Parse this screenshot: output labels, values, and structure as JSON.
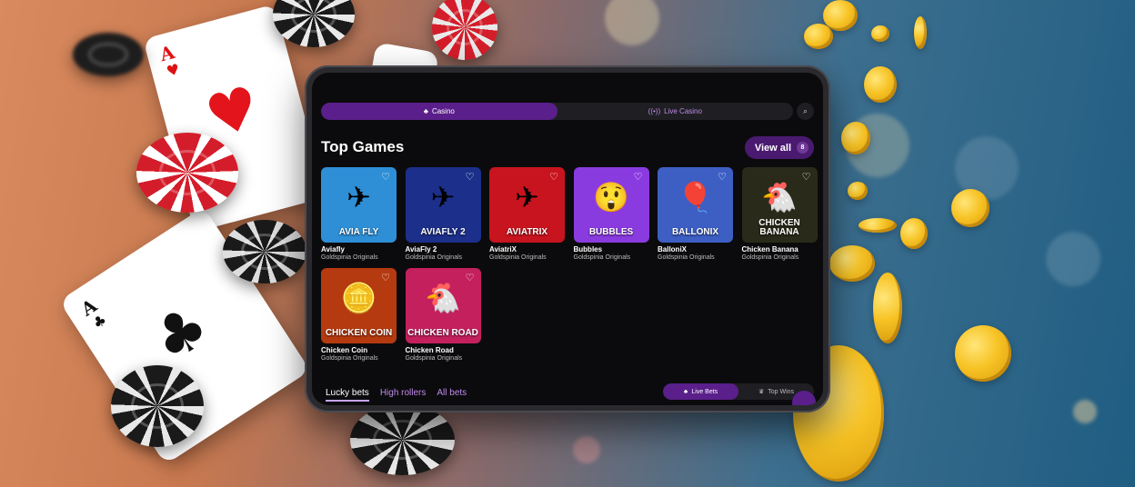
{
  "nav": {
    "casino_label": "Casino",
    "live_casino_label": "Live Casino",
    "search_icon": "search-icon"
  },
  "top_games": {
    "title": "Top Games",
    "view_all_label": "View all",
    "view_all_count": "8"
  },
  "games": [
    {
      "name": "Aviafly",
      "provider": "Goldspinia Originals",
      "logo": "AVIA FLY",
      "art": "✈",
      "bg": "#2e8fd6"
    },
    {
      "name": "AviaFly 2",
      "provider": "Goldspinia Originals",
      "logo": "AVIAFLY 2",
      "art": "✈",
      "bg": "#1c2f8a"
    },
    {
      "name": "AviatriX",
      "provider": "Goldspinia Originals",
      "logo": "AVIATRIX",
      "art": "✈",
      "bg": "#c8141e"
    },
    {
      "name": "Bubbles",
      "provider": "Goldspinia Originals",
      "logo": "BUBBLES",
      "art": "😲",
      "bg": "#8a3be0"
    },
    {
      "name": "BalloniX",
      "provider": "Goldspinia Originals",
      "logo": "BALLONIX",
      "art": "🎈",
      "bg": "#3d5fc4"
    },
    {
      "name": "Chicken Banana",
      "provider": "Goldspinia Originals",
      "logo": "CHICKEN BANANA",
      "art": "🐔",
      "bg": "#2a2a1a"
    },
    {
      "name": "Chicken Coin",
      "provider": "Goldspinia Originals",
      "logo": "CHICKEN COIN",
      "art": "🪙",
      "bg": "#b53a10"
    },
    {
      "name": "Chicken Road",
      "provider": "Goldspinia Originals",
      "logo": "CHICKEN ROAD",
      "art": "🐔",
      "bg": "#c4205e"
    }
  ],
  "bets": {
    "tabs": [
      "Lucky bets",
      "High rollers",
      "All bets"
    ],
    "live_bets_label": "Live Bets",
    "top_wins_label": "Top Wins"
  },
  "colors": {
    "accent": "#5a1f8a",
    "accent_text": "#c08ae8"
  }
}
